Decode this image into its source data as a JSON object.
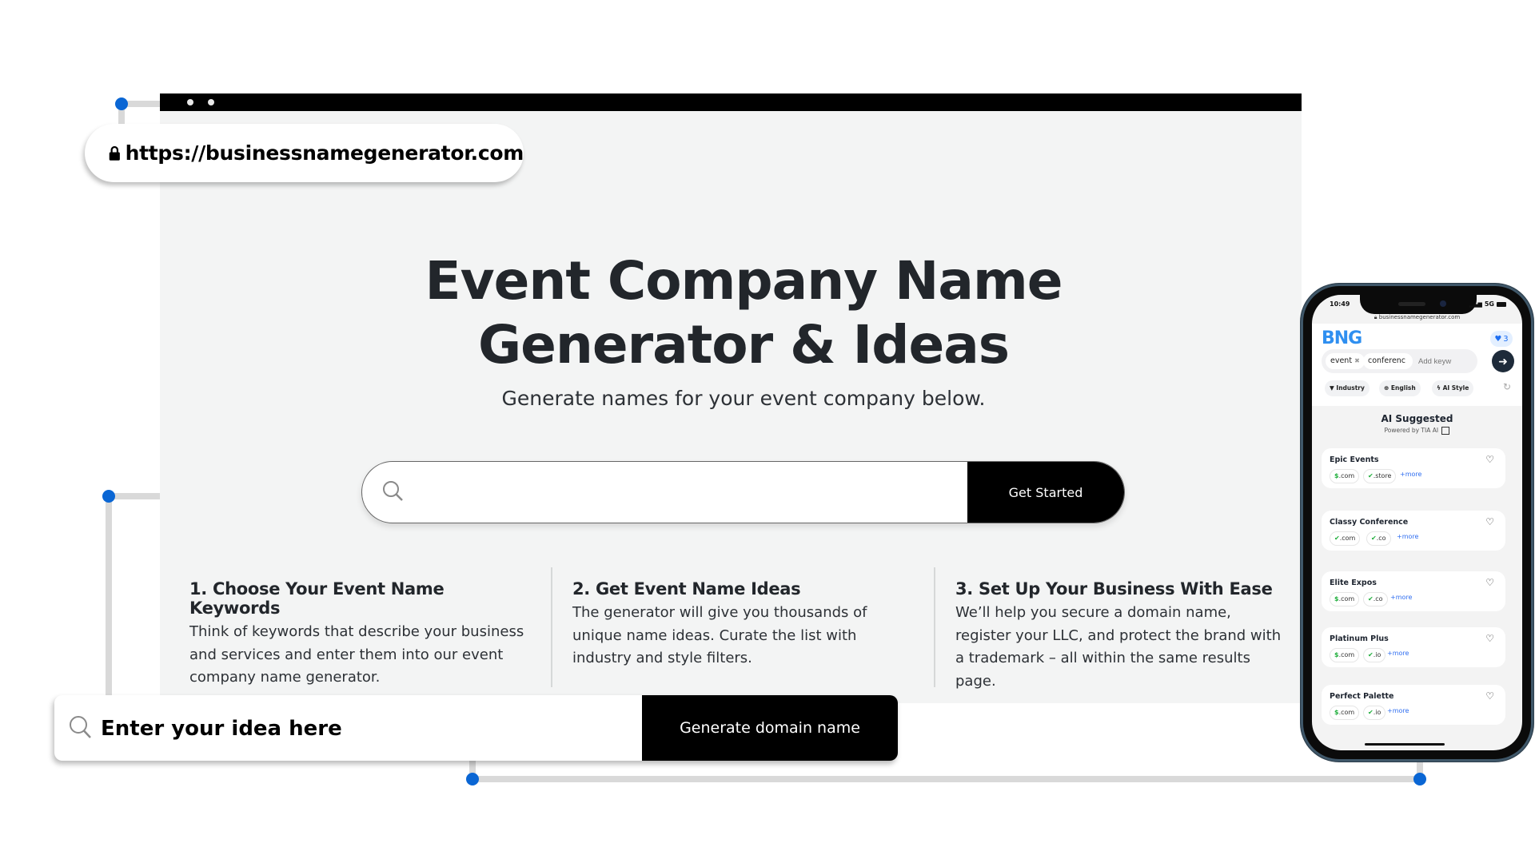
{
  "browser": {
    "url": "https://businessnamegenerator.com",
    "lock_icon": "lock-icon"
  },
  "hero": {
    "title_line1": "Event Company Name",
    "title_line2": "Generator & Ideas",
    "subtitle": "Generate names for your event company below."
  },
  "search": {
    "placeholder": "",
    "value": "",
    "button_label": "Get Started",
    "icon": "search-icon"
  },
  "steps": [
    {
      "title": "1. Choose Your Event Name Keywords",
      "text": "Think of keywords that describe your business and services and enter them into our event company name generator."
    },
    {
      "title": "2. Get Event Name Ideas",
      "text": "The generator will give you thousands of unique name ideas. Curate the list with industry and style filters."
    },
    {
      "title": "3. Set Up Your Business With Ease",
      "text": "We’ll help you secure a domain name, register your LLC, and protect the brand with a trademark – all within the same results page."
    }
  ],
  "idea_bar": {
    "placeholder": "Enter your idea here",
    "button_label": "Generate domain name"
  },
  "phone": {
    "time": "10:49",
    "network": "5G",
    "url": "businessnamegenerator.com",
    "logo": "BNG",
    "favorites_count": "3",
    "keywords": [
      "event",
      "conferenc"
    ],
    "keyword_placeholder": "Add keyw",
    "filters": [
      {
        "label": "Industry",
        "icon": "funnel-icon"
      },
      {
        "label": "English",
        "icon": "globe-icon"
      },
      {
        "label": "AI Style",
        "icon": "bolt-icon"
      }
    ],
    "section_title": "AI Suggested",
    "section_subtitle": "Powered by TIA AI",
    "more_label": "+more",
    "results": [
      {
        "name": "Epic Events",
        "tlds": [
          {
            "status": "$",
            "tld": ".com"
          },
          {
            "status": "✔",
            "tld": ".store"
          }
        ]
      },
      {
        "name": "Classy Conference",
        "tlds": [
          {
            "status": "✔",
            "tld": ".com"
          },
          {
            "status": "✔",
            "tld": ".co"
          }
        ]
      },
      {
        "name": "Elite Expos",
        "tlds": [
          {
            "status": "$",
            "tld": ".com"
          },
          {
            "status": "✔",
            "tld": ".co"
          }
        ]
      },
      {
        "name": "Platinum Plus",
        "tlds": [
          {
            "status": "$",
            "tld": ".com"
          },
          {
            "status": "✔",
            "tld": ".io"
          }
        ]
      },
      {
        "name": "Perfect Palette",
        "tlds": [
          {
            "status": "$",
            "tld": ".com"
          },
          {
            "status": "✔",
            "tld": ".io"
          }
        ]
      }
    ]
  },
  "colors": {
    "accent_dot": "#0a66d4",
    "connector": "#d9d9d9",
    "brand_blue": "#2f8ff0",
    "available_green": "#1fae3b",
    "link_blue": "#2f6ef0"
  }
}
